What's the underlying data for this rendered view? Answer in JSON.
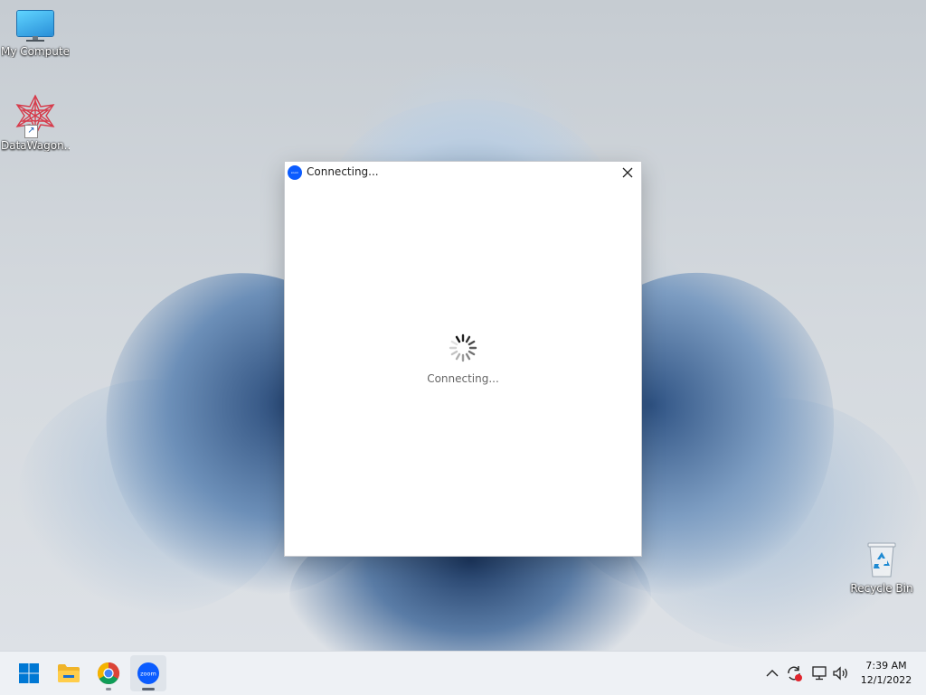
{
  "desktop": {
    "icons": [
      {
        "label": "My Computer",
        "icon": "computer-icon"
      },
      {
        "label": "DataWagon...",
        "icon": "datawagon-icon"
      },
      {
        "label": "Recycle Bin",
        "icon": "recycle-bin-icon"
      }
    ]
  },
  "dialog": {
    "title": "Connecting...",
    "status": "Connecting...",
    "app_icon_text": "zoom",
    "close_icon": "close-icon",
    "spinner_icon": "loading-spinner-icon"
  },
  "taskbar": {
    "apps": [
      {
        "name": "Start",
        "icon": "windows-start-icon"
      },
      {
        "name": "File Explorer",
        "icon": "folder-icon"
      },
      {
        "name": "Google Chrome",
        "icon": "chrome-icon"
      },
      {
        "name": "Zoom",
        "icon": "zoom-icon",
        "label": "zoom",
        "active": true
      }
    ],
    "tray_icons": [
      "chevron-up-icon",
      "sync-alert-icon",
      "network-icon",
      "volume-icon"
    ]
  },
  "clock": {
    "time": "7:39 AM",
    "date": "12/1/2022"
  },
  "colors": {
    "zoom_blue": "#0b5cff",
    "alert_red": "#e0242d",
    "windows_blue": "#0078d4"
  }
}
